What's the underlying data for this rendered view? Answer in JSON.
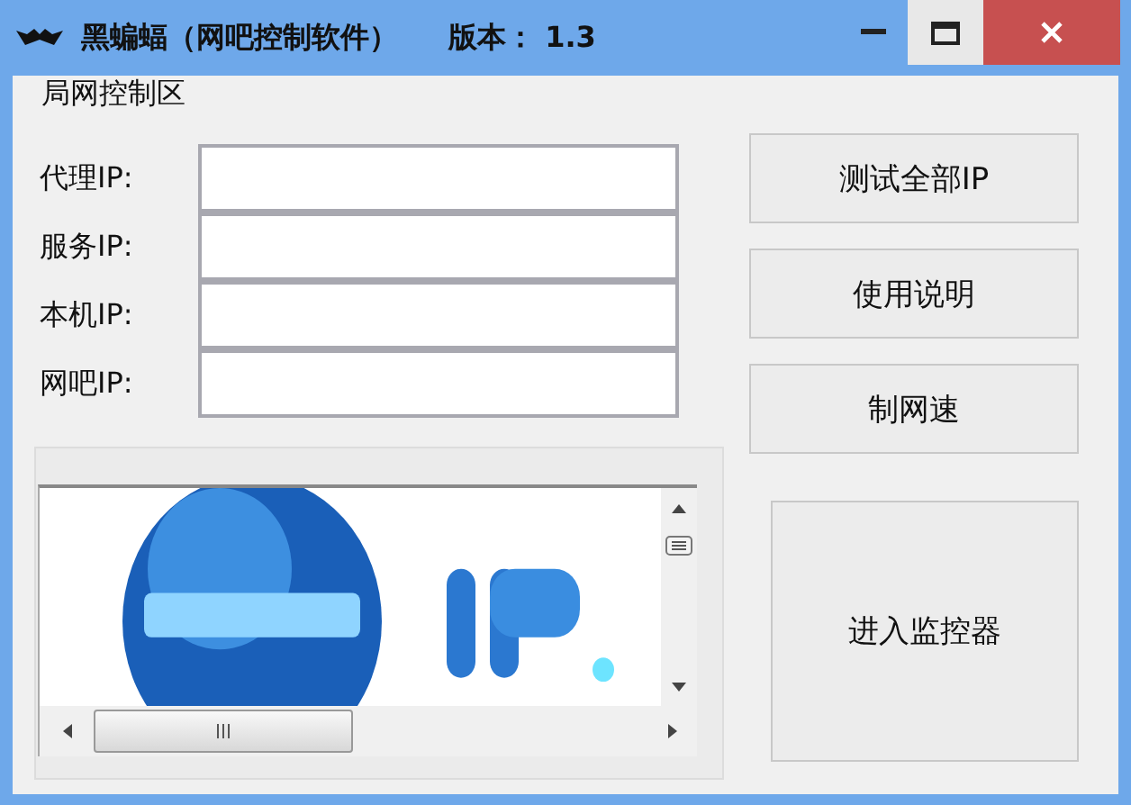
{
  "window": {
    "title": "黑蝙蝠（网吧控制软件）",
    "version": "版本： 1.3"
  },
  "group": {
    "title": "局网控制区"
  },
  "fields": [
    {
      "label": "代理IP:"
    },
    {
      "label": "服务IP:"
    },
    {
      "label": "本机IP:"
    },
    {
      "label": "网吧IP:"
    }
  ],
  "side_buttons": [
    "测试全部IP",
    "使用说明",
    "制网速"
  ],
  "main_button": "进入监控器",
  "banner": {
    "kind": "picture"
  }
}
